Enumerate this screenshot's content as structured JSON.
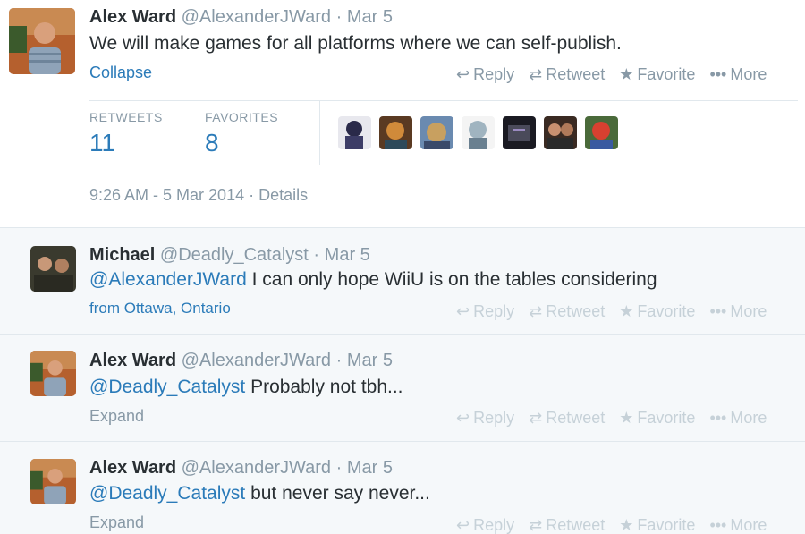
{
  "main_tweet": {
    "name": "Alex Ward",
    "handle": "@AlexanderJWard",
    "separator": "·",
    "date": "Mar 5",
    "text": "We will make games for all platforms where we can self-publish.",
    "collapse_label": "Collapse",
    "actions": {
      "reply": "Reply",
      "retweet": "Retweet",
      "favorite": "Favorite",
      "more": "More"
    },
    "stats": {
      "retweets_label": "RETWEETS",
      "retweets": "11",
      "favorites_label": "FAVORITES",
      "favorites": "8"
    },
    "timestamp": "9:26 AM - 5 Mar 2014",
    "details_label": "Details"
  },
  "replies": [
    {
      "name": "Michael",
      "handle": "@Deadly_Catalyst",
      "separator": "·",
      "date": "Mar 5",
      "mention": "@AlexanderJWard",
      "text": " I can only hope WiiU is on the tables considering",
      "footer": "from Ottawa, Ontario",
      "actions": {
        "reply": "Reply",
        "retweet": "Retweet",
        "favorite": "Favorite",
        "more": "More"
      }
    },
    {
      "name": "Alex Ward",
      "handle": "@AlexanderJWard",
      "separator": "·",
      "date": "Mar 5",
      "mention": "@Deadly_Catalyst",
      "text": " Probably not tbh...",
      "footer": "Expand",
      "actions": {
        "reply": "Reply",
        "retweet": "Retweet",
        "favorite": "Favorite",
        "more": "More"
      }
    },
    {
      "name": "Alex Ward",
      "handle": "@AlexanderJWard",
      "separator": "·",
      "date": "Mar 5",
      "mention": "@Deadly_Catalyst",
      "text": " but never say never...",
      "footer": "Expand",
      "actions": {
        "reply": "Reply",
        "retweet": "Retweet",
        "favorite": "Favorite",
        "more": "More"
      }
    }
  ],
  "icons": {
    "reply": "reply-icon",
    "retweet": "retweet-icon",
    "favorite": "star-icon",
    "more": "more-dots-icon"
  },
  "colors": {
    "link": "#2b7bb9",
    "muted": "#8899a6",
    "reply_bg": "#f5f8fa"
  }
}
